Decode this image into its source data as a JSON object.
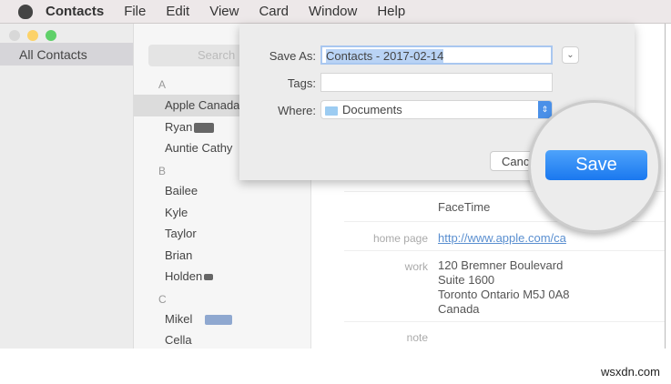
{
  "menubar": {
    "app": "Contacts",
    "items": [
      "File",
      "Edit",
      "View",
      "Card",
      "Window",
      "Help"
    ]
  },
  "sidebar": {
    "all_contacts": "All Contacts"
  },
  "list": {
    "search_placeholder": "Search",
    "sections": [
      {
        "letter": "A",
        "contacts": [
          "Apple Canada",
          "Ryan",
          "Auntie Cathy"
        ]
      },
      {
        "letter": "B",
        "contacts": [
          "Bailee",
          "Kyle",
          "Taylor",
          "Brian",
          "Holden"
        ]
      },
      {
        "letter": "C",
        "contacts": [
          "Mikel",
          "Cella"
        ]
      }
    ],
    "selected": "Apple Canada"
  },
  "detail": {
    "facetime": "FaceTime",
    "home_page_label": "home page",
    "home_page": "http://www.apple.com/ca",
    "work_label": "work",
    "address": [
      "120 Bremner Boulevard",
      "Suite 1600",
      "Toronto Ontario M5J 0A8",
      "Canada"
    ],
    "note_label": "note"
  },
  "dialog": {
    "save_as_label": "Save As:",
    "save_as_value": "Contacts - 2017-02-14",
    "tags_label": "Tags:",
    "tags_value": "",
    "where_label": "Where:",
    "where_value": "Documents",
    "cancel": "Cancel",
    "save": "Save"
  },
  "watermark": "wsxdn.com",
  "colors": {
    "accent": "#1a78ef"
  }
}
